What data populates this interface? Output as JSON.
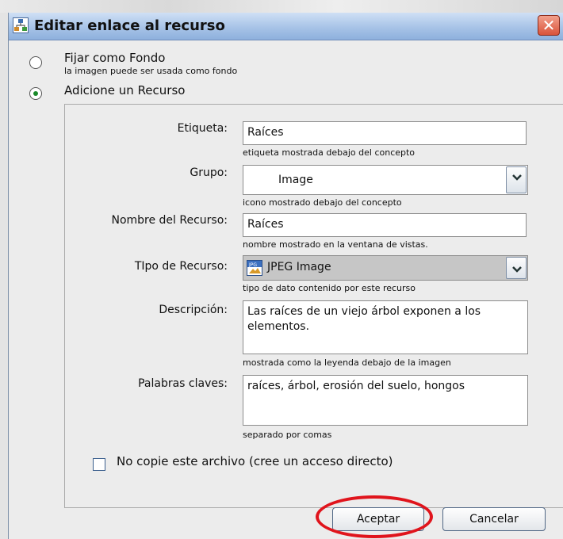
{
  "dialog": {
    "title": "Editar enlace al recurso",
    "close_label": "✕"
  },
  "options": {
    "background": {
      "label": "Fijar como Fondo",
      "description": "la imagen puede ser usada como fondo",
      "selected": false
    },
    "resource": {
      "label": "Adicione un Recurso",
      "selected": true
    }
  },
  "form": {
    "label_field": {
      "label": "Etiqueta:",
      "value": "Raíces",
      "hint": "etiqueta mostrada debajo del concepto"
    },
    "group_field": {
      "label": "Grupo:",
      "value": "Image",
      "hint": "icono mostrado debajo del concepto"
    },
    "resource_name_field": {
      "label": "Nombre del Recurso:",
      "value": "Raíces",
      "hint": "nombre mostrado en la ventana de vistas."
    },
    "resource_type_field": {
      "label": "TIpo de Recurso:",
      "value": "JPEG Image",
      "icon": "jpeg-file-icon",
      "hint": "tipo de dato contenido por este recurso"
    },
    "description_field": {
      "label": "Descripción:",
      "value": "Las raíces de un viejo árbol exponen a los elementos.",
      "hint": "mostrada como la leyenda debajo de la imagen"
    },
    "keywords_field": {
      "label": "Palabras claves:",
      "value": "raíces, árbol, erosión del suelo, hongos",
      "hint": "separado por comas"
    },
    "no_copy_checkbox": {
      "label": "No copie este archivo  (cree un acceso directo)",
      "checked": false
    }
  },
  "buttons": {
    "accept": "Aceptar",
    "cancel": "Cancelar"
  },
  "colors": {
    "highlight": "#e0141c",
    "titlebar": "#a7c3e7"
  }
}
